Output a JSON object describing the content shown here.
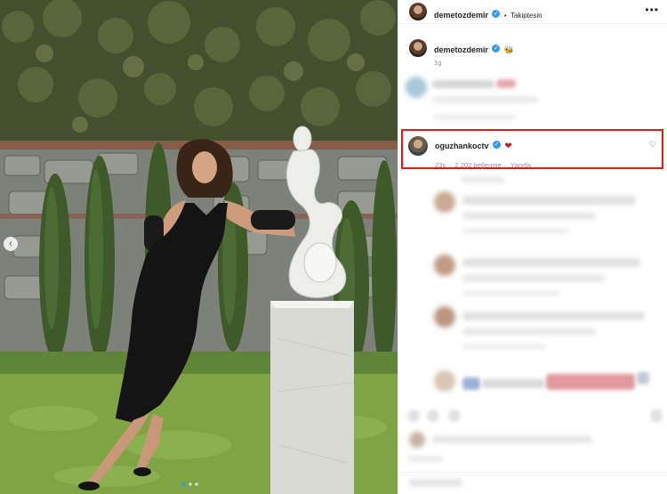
{
  "post": {
    "username": "demetozdemir",
    "follow_status": "Takiptesin",
    "separator": "•",
    "more_icon": "more-horizontal-icon",
    "caption_emoji": "🐝",
    "time_ago": "1g"
  },
  "highlighted_comment": {
    "username": "oguzhankoctv",
    "text": "❤",
    "time_ago": "23s",
    "likes": "2.202 beğenme",
    "reply": "Yanıtla",
    "like_icon": "heart-outline-icon"
  },
  "colors": {
    "highlight_border": "#e0191f",
    "verified": "#3897f0",
    "heart": "#c41e2e"
  }
}
